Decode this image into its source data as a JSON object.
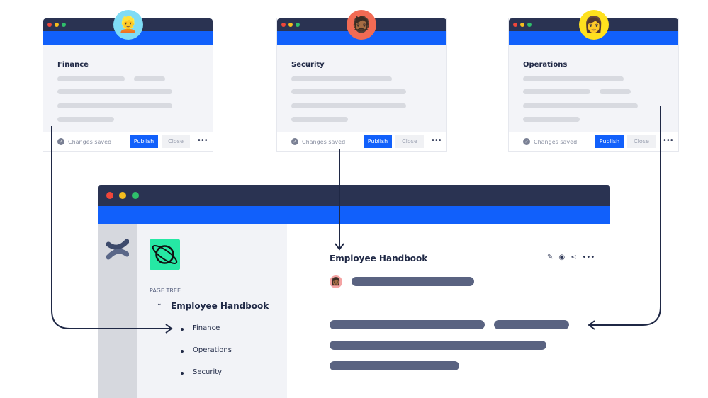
{
  "cards": [
    {
      "title": "Finance",
      "status": "Changes saved",
      "publish": "Publish",
      "close": "Close",
      "avatar": "👱",
      "avatar_color": "#7fdcf5"
    },
    {
      "title": "Security",
      "status": "Changes saved",
      "publish": "Publish",
      "close": "Close",
      "avatar": "🧔🏾",
      "avatar_color": "#f26b54"
    },
    {
      "title": "Operations",
      "status": "Changes saved",
      "publish": "Publish",
      "close": "Close",
      "avatar": "👩",
      "avatar_color": "#ffe11e"
    }
  ],
  "main": {
    "sidebar": {
      "section_label": "PAGE TREE",
      "root": "Employee Handbook",
      "children": [
        "Finance",
        "Operations",
        "Security"
      ]
    },
    "page_title": "Employee Handbook",
    "actions": [
      "pencil-icon",
      "eye-icon",
      "share-icon",
      "more-icon"
    ]
  },
  "colors": {
    "titlebar": "#2a3352",
    "accent": "#1160fb",
    "space_icon": "#26e8a4"
  }
}
